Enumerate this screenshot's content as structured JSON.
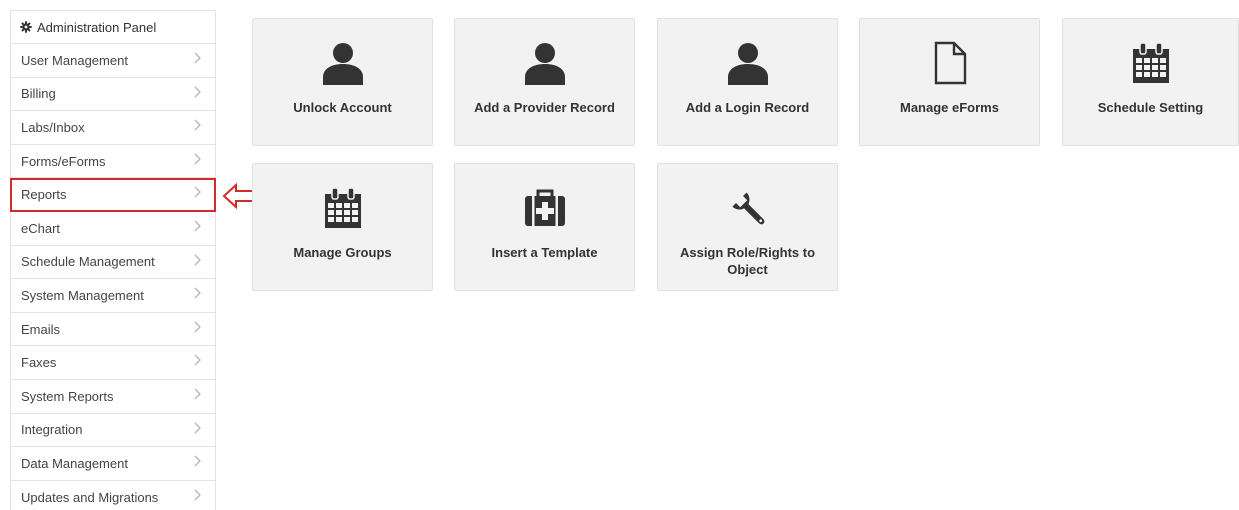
{
  "sidebar": {
    "header": "Administration Panel",
    "items": [
      {
        "label": "User Management"
      },
      {
        "label": "Billing"
      },
      {
        "label": "Labs/Inbox"
      },
      {
        "label": "Forms/eForms"
      },
      {
        "label": "Reports",
        "highlighted": true
      },
      {
        "label": "eChart"
      },
      {
        "label": "Schedule Management"
      },
      {
        "label": "System Management"
      },
      {
        "label": "Emails"
      },
      {
        "label": "Faxes"
      },
      {
        "label": "System Reports"
      },
      {
        "label": "Integration"
      },
      {
        "label": "Data Management"
      },
      {
        "label": "Updates and Migrations"
      }
    ]
  },
  "tiles": [
    {
      "label": "Unlock Account",
      "icon": "user-icon"
    },
    {
      "label": "Add a Provider Record",
      "icon": "user-icon"
    },
    {
      "label": "Add a Login Record",
      "icon": "user-icon"
    },
    {
      "label": "Manage eForms",
      "icon": "file-icon"
    },
    {
      "label": "Schedule Setting",
      "icon": "calendar-icon"
    },
    {
      "label": "Manage Groups",
      "icon": "calendar-icon"
    },
    {
      "label": "Insert a Template",
      "icon": "medkit-icon"
    },
    {
      "label": "Assign Role/Rights to Object",
      "icon": "wrench-icon"
    }
  ],
  "colors": {
    "highlight": "#d42a2a",
    "tile_bg": "#f2f2f2",
    "icon": "#333333"
  }
}
